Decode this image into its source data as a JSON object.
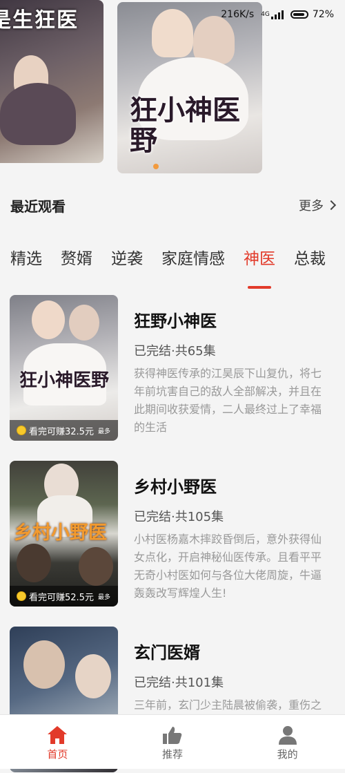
{
  "status_bar": {
    "speed": "216K/s",
    "network": "4G",
    "battery": "72%"
  },
  "banners": [
    {
      "title_text": "是生狂医"
    },
    {
      "title_text": "狂小神医野"
    }
  ],
  "recent": {
    "title": "最近观看",
    "more": "更多"
  },
  "tabs": [
    "精选",
    "赘婿",
    "逆袭",
    "家庭情感",
    "神医",
    "总裁"
  ],
  "active_tab": 4,
  "dramas": [
    {
      "name": "狂野小神医",
      "status": "已完结·共65集",
      "desc": "获得神医传承的江昊辰下山复仇，将七年前坑害自己的敌人全部解决，并且在此期间收获爱情，二人最终过上了幸福的生活",
      "earn": "看完可赚32.5元",
      "earn_suffix": "最多",
      "cover_text": "狂小神医野"
    },
    {
      "name": "乡村小野医",
      "status": "已完结·共105集",
      "desc": "小村医杨嘉木摔跤昏倒后，意外获得仙女点化，开启神秘仙医传承。且看平平无奇小村医如何与各位大佬周旋，牛逼轰轰改写辉煌人生!",
      "earn": "看完可赚52.5元",
      "earn_suffix": "最多",
      "cover_text": "乡村小野医"
    },
    {
      "name": "玄门医婿",
      "status": "已完结·共101集",
      "desc": "三年前，玄门少主陆晨被偷袭，重伤之下被中州苏家老爷子所救，并定下"
    }
  ],
  "bottom_nav": [
    {
      "label": "首页",
      "icon": "home-icon"
    },
    {
      "label": "推荐",
      "icon": "thumbs-up-icon"
    },
    {
      "label": "我的",
      "icon": "user-icon"
    }
  ],
  "colors": {
    "accent": "#e23a2a",
    "background": "#f4f4f4"
  }
}
